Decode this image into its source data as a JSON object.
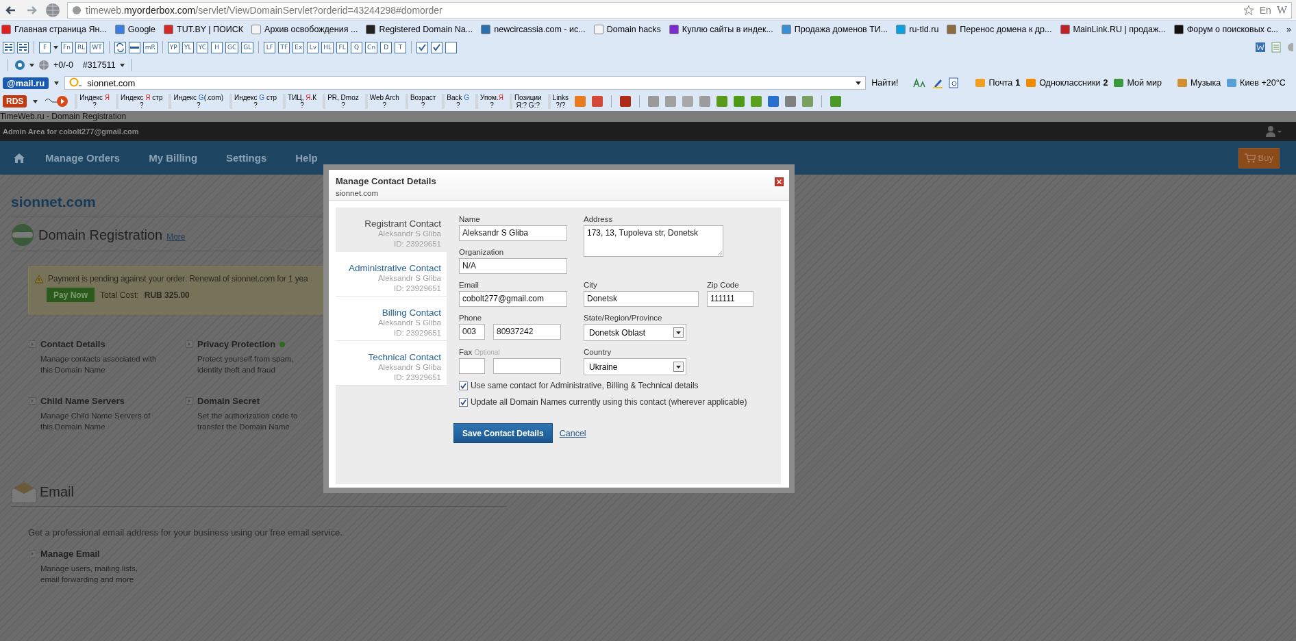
{
  "browser": {
    "url": "timeweb.**myorderbox.com**/servlet/ViewDomainServlet?orderid=43244298#domorder",
    "input_language": "En",
    "edge_letter": "W",
    "bookmarks": [
      {
        "label": "Главная страница Ян...",
        "color": "#e02020"
      },
      {
        "label": "Google",
        "color": "#3b7de0"
      },
      {
        "label": "TUT.BY | ПОИСК",
        "color": "#d02a2a"
      },
      {
        "label": "Архив освобождения ...",
        "color": "#f4f4f4"
      },
      {
        "label": "Registered Domain Na...",
        "color": "#222222"
      },
      {
        "label": "newcircassia.com - ис...",
        "color": "#2a6fb0"
      },
      {
        "label": "Domain hacks",
        "color": "#f5f5f5"
      },
      {
        "label": "Куплю сайты в индек...",
        "color": "#7a2ad0"
      },
      {
        "label": "Продажа доменов ТИ...",
        "color": "#3a8fd0"
      },
      {
        "label": "ru-tld.ru",
        "color": "#0ba0e0"
      },
      {
        "label": "Перенос домена к др...",
        "color": "#8a6a40"
      },
      {
        "label": "MainLink.RU | продаж...",
        "color": "#c0202a"
      },
      {
        "label": "Форум о поисковых с...",
        "color": "#111111"
      }
    ],
    "more_bookmarks": "»",
    "seo_toolbar": [
      {
        "kind": "grid"
      },
      {
        "kind": "grid"
      },
      {
        "kind": "separator"
      },
      {
        "kind": "text",
        "label": "F",
        "dropdown": true
      },
      {
        "kind": "text",
        "label": "Fn"
      },
      {
        "kind": "text",
        "label": "RL"
      },
      {
        "kind": "text",
        "label": "WT"
      },
      {
        "kind": "separator"
      },
      {
        "kind": "refresh"
      },
      {
        "kind": "bar"
      },
      {
        "kind": "text",
        "label": "mR"
      },
      {
        "kind": "separator"
      },
      {
        "kind": "text",
        "label": "YP"
      },
      {
        "kind": "text",
        "label": "YL"
      },
      {
        "kind": "text",
        "label": "YC"
      },
      {
        "kind": "text",
        "label": "H"
      },
      {
        "kind": "text",
        "label": "GC"
      },
      {
        "kind": "text",
        "label": "GL"
      },
      {
        "kind": "separator"
      },
      {
        "kind": "text",
        "label": "LF"
      },
      {
        "kind": "text",
        "label": "TF"
      },
      {
        "kind": "text",
        "label": "Ex"
      },
      {
        "kind": "text",
        "label": "Lv"
      },
      {
        "kind": "text",
        "label": "HL"
      },
      {
        "kind": "text",
        "label": "FL"
      },
      {
        "kind": "text",
        "label": "Q"
      },
      {
        "kind": "text",
        "label": "Cn"
      },
      {
        "kind": "text",
        "label": "D"
      },
      {
        "kind": "text",
        "label": "T"
      },
      {
        "kind": "separator"
      },
      {
        "kind": "check",
        "checked": true
      },
      {
        "kind": "check",
        "checked": true
      },
      {
        "kind": "check",
        "checked": false
      }
    ],
    "counter_toolbar": {
      "backlinks": "+0/-0",
      "rank": "#317511"
    },
    "mail_toolbar": {
      "logo": "@mail.ru",
      "search": {
        "value": "sionnet.com"
      },
      "search_button": "Найти!",
      "links": [
        {
          "label": "Почта",
          "count": "1",
          "color": "#f0a020"
        },
        {
          "label": "Одноклассники",
          "count": "2",
          "color": "#f08a00"
        },
        {
          "label": "Мой мир",
          "color": "#3a9a3a"
        },
        {
          "label": "Музыка",
          "color": "#d09030"
        },
        {
          "label": "Киев +20°C",
          "color": "#5aa0d8"
        }
      ]
    },
    "rds_toolbar": {
      "logo": "RDS",
      "metrics": [
        {
          "parts": [
            {
              "text": "Индекс "
            },
            {
              "text": "Я",
              "color": "#e02020"
            }
          ],
          "value": "?"
        },
        {
          "parts": [
            {
              "text": "Индекс "
            },
            {
              "text": "Я",
              "color": "#e02020"
            },
            {
              "text": " стр"
            }
          ],
          "value": "?"
        },
        {
          "parts": [
            {
              "text": "Индекс "
            },
            {
              "text": "G",
              "color": "#2a6fd0"
            },
            {
              "text": "(.com)"
            }
          ],
          "value": "?"
        },
        {
          "parts": [
            {
              "text": "Индекс "
            },
            {
              "text": "G",
              "color": "#2a6fd0"
            },
            {
              "text": " стр"
            }
          ],
          "value": "?"
        },
        {
          "parts": [
            {
              "text": "ТИЦ, "
            },
            {
              "text": "Я",
              "color": "#e02020"
            },
            {
              "text": ".К"
            }
          ],
          "value": "?"
        },
        {
          "parts": [
            {
              "text": "PR, Dmoz"
            }
          ],
          "value": "?"
        },
        {
          "parts": [
            {
              "text": "Web Arch"
            }
          ],
          "value": "?"
        },
        {
          "parts": [
            {
              "text": "Возраст"
            }
          ],
          "value": "?"
        },
        {
          "parts": [
            {
              "text": "Back "
            },
            {
              "text": "G",
              "color": "#2a6fd0"
            }
          ],
          "value": "?"
        },
        {
          "parts": [
            {
              "text": "Упом."
            },
            {
              "text": "Я",
              "color": "#e02020"
            }
          ],
          "value": "?"
        },
        {
          "parts": [
            {
              "text": "Позиции"
            }
          ],
          "value": "Я:? G:?"
        },
        {
          "parts": [
            {
              "text": "Links"
            }
          ],
          "value": "?/?"
        }
      ],
      "tools": [
        {
          "color": "#e87b1e"
        },
        {
          "color": "#d34836"
        },
        {
          "color": "#b02a1a"
        },
        {
          "color": "#9a9a9a"
        },
        {
          "color": "#a0a0a0"
        },
        {
          "color": "#a8a8a8"
        },
        {
          "color": "#9c9c9c"
        },
        {
          "color": "#5a9a1a"
        },
        {
          "color": "#4e9a16"
        },
        {
          "color": "#58a020"
        },
        {
          "color": "#2a6fd0"
        },
        {
          "color": "#808080"
        },
        {
          "color": "#7aa060"
        },
        {
          "color": "#4a9a2a"
        }
      ]
    }
  },
  "page": {
    "document_title": "TimeWeb.ru - Domain Registration",
    "admin_label": "Admin Area for cobolt277@gmail.com",
    "nav": [
      {
        "label": "Manage Orders"
      },
      {
        "label": "My Billing"
      },
      {
        "label": "Settings"
      },
      {
        "label": "Help"
      }
    ],
    "buy_button": "Buy",
    "domain": "sionnet.com",
    "sections": [
      {
        "kind": "domain",
        "title": "Domain Registration",
        "link": "More",
        "alert": {
          "message": "Payment is pending against your order: Renewal of sionnet.com for 1 yea",
          "button": "Pay Now",
          "cost_label": "Total Cost:",
          "cost": "RUB 325.00"
        },
        "tiles": [
          {
            "title": "Contact Details",
            "description": "Manage contacts associated with this Domain Name"
          },
          {
            "title": "Privacy Protection",
            "enabled": true,
            "description": "Protect yourself from spam, identity theft and fraud"
          },
          {
            "title": "Child Name Servers",
            "description": "Manage Child Name Servers of this Domain Name"
          },
          {
            "title": "Domain Secret",
            "description": "Set the authorization code to transfer the Domain Name"
          }
        ]
      },
      {
        "kind": "email",
        "title": "Email",
        "description": "Get a professional email address for your business using our free email service.",
        "tiles": [
          {
            "title": "Manage Email",
            "description": "Manage users, mailing lists, email forwarding and more"
          }
        ]
      }
    ]
  },
  "dialog": {
    "title": "Manage Contact Details",
    "subtitle": "sionnet.com",
    "contacts": [
      {
        "role": "Registrant Contact",
        "name": "Aleksandr S Gliba",
        "id": "ID: 23929651",
        "selected": true
      },
      {
        "role": "Administrative Contact",
        "name": "Aleksandr S Gliba",
        "id": "ID: 23929651",
        "selected": false
      },
      {
        "role": "Billing Contact",
        "name": "Aleksandr S Gliba",
        "id": "ID: 23929651",
        "selected": false
      },
      {
        "role": "Technical Contact",
        "name": "Aleksandr S Gliba",
        "id": "ID: 23929651",
        "selected": false
      }
    ],
    "form": {
      "name": {
        "label": "Name",
        "value": "Aleksandr S Gliba"
      },
      "address": {
        "label": "Address",
        "value": "173, 13, Tupoleva str, Donetsk"
      },
      "organization": {
        "label": "Organization",
        "value": "N/A"
      },
      "email": {
        "label": "Email",
        "value": "cobolt277@gmail.com"
      },
      "city": {
        "label": "City",
        "value": "Donetsk"
      },
      "zip": {
        "label": "Zip Code",
        "value": "111111"
      },
      "phone": {
        "label": "Phone",
        "code": "003",
        "number": "80937242"
      },
      "state": {
        "label": "State/Region/Province",
        "value": "Donetsk Oblast"
      },
      "fax": {
        "label": "Fax",
        "hint": "Optional"
      },
      "country": {
        "label": "Country",
        "value": "Ukraine"
      }
    },
    "options": [
      {
        "label": "Use same contact for Administrative, Billing & Technical details",
        "checked": true
      },
      {
        "label": "Update all Domain Names currently using this contact (wherever applicable)",
        "checked": true
      }
    ],
    "save_button": "Save Contact Details",
    "cancel_link": "Cancel"
  }
}
